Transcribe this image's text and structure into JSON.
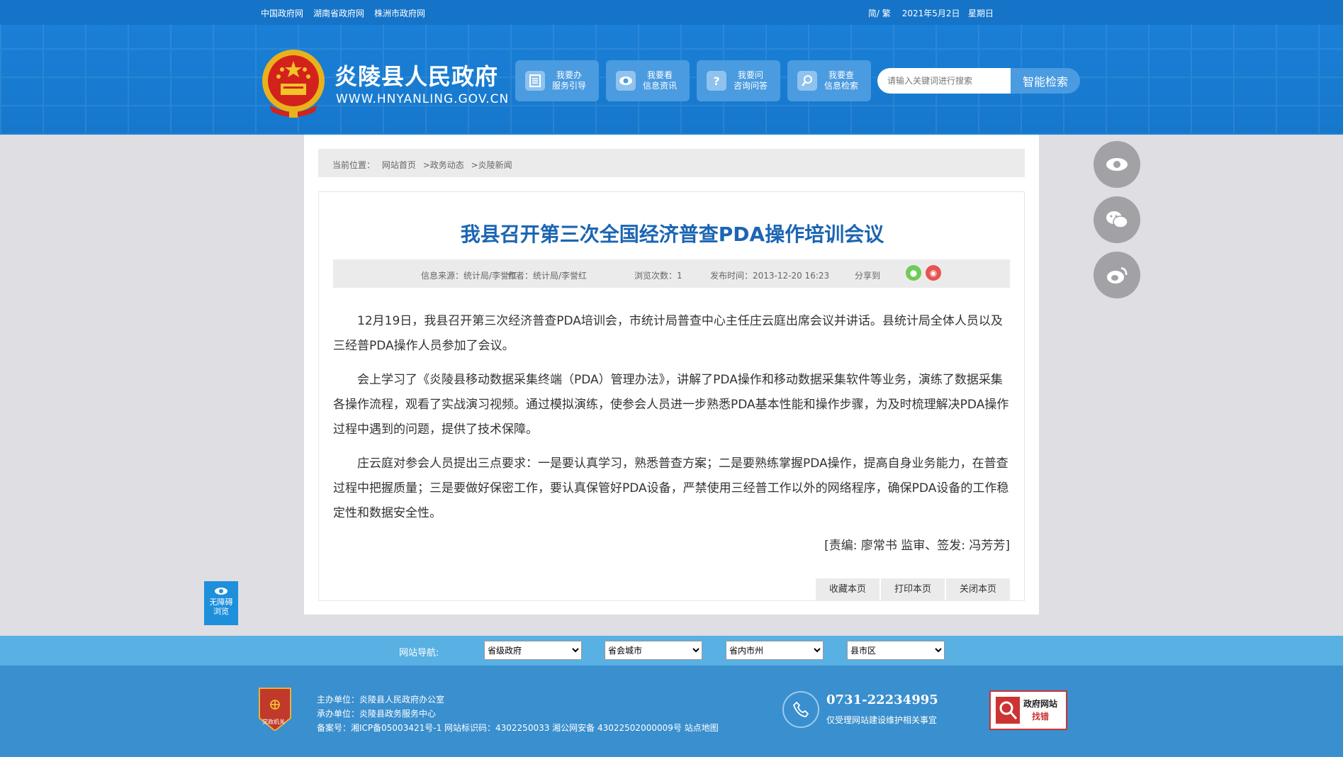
{
  "topbar": {
    "links": [
      "中国政府网",
      "湖南省政府网",
      "株洲市政府网"
    ],
    "lang": "简/ 繁",
    "date": "2021年5月2日",
    "weekday": "星期日"
  },
  "header": {
    "title": "炎陵县人民政府",
    "url": "WWW.HNYANLING.GOV.CN",
    "nav": [
      {
        "line1": "我要办",
        "line2": "服务引导",
        "icon": "document-icon"
      },
      {
        "line1": "我要看",
        "line2": "信息资讯",
        "icon": "eye-icon"
      },
      {
        "line1": "我要问",
        "line2": "咨询问答",
        "icon": "question-icon"
      },
      {
        "line1": "我要查",
        "line2": "信息检索",
        "icon": "search-icon"
      }
    ],
    "search_placeholder": "请输入关键词进行搜索",
    "search_button": "智能检索"
  },
  "breadcrumb": {
    "label": "当前位置：",
    "items": [
      "网站首页",
      ">政务动态",
      ">炎陵新闻"
    ]
  },
  "article": {
    "title": "我县召开第三次全国经济普查PDA操作培训会议",
    "source": "信息来源：统计局/李誉红",
    "author": "作者：统计局/李誉红",
    "views": "浏览次数：1",
    "published": "发布时间：2013-12-20 16:23",
    "share": "分享到",
    "paragraphs": [
      "12月19日，我县召开第三次经济普查PDA培训会，市统计局普查中心主任庄云庭出席会议并讲话。县统计局全体人员以及三经普PDA操作人员参加了会议。",
      "会上学习了《炎陵县移动数据采集终端（PDA）管理办法》，讲解了PDA操作和移动数据采集软件等业务，演练了数据采集各操作流程，观看了实战演习视频。通过模拟演练，使参会人员进一步熟悉PDA基本性能和操作步骤，为及时梳理解决PDA操作过程中遇到的问题，提供了技术保障。",
      "庄云庭对参会人员提出三点要求：一是要认真学习，熟悉普查方案；二是要熟练掌握PDA操作，提高自身业务能力，在普查过程中把握质量；三是要做好保密工作，要认真保管好PDA设备，严禁使用三经普工作以外的网络程序，确保PDA设备的工作稳定性和数据安全性。"
    ],
    "editor": "[责编: 廖常书  监审、签发: 冯芳芳]",
    "actions": [
      "收藏本页",
      "打印本页",
      "关闭本页"
    ]
  },
  "accessibility": {
    "line1": "无障碍",
    "line2": "浏览"
  },
  "footnav": {
    "label": "网站导航:",
    "selects": [
      "省级政府",
      "省会城市",
      "省内市州",
      "县市区"
    ]
  },
  "footer": {
    "host": "主办单位：炎陵县人民政府办公室",
    "organizer": "承办单位：炎陵县政务服务中心",
    "record": "备案号：湘ICP备05003421号-1  网站标识码：4302250033  湘公网安备 43022502000009号  站点地图",
    "phone": "0731-22234995",
    "phone_note": "仅受理网站建设维护相关事宜",
    "jiucuo_line1": "政府网站",
    "jiucuo_line2": "找错",
    "badge_text": "党政机关"
  },
  "colors": {
    "header_blue": "#1674c8",
    "title_blue": "#1b65b3",
    "footer_blue": "#3a8fce",
    "nav_blue": "#58b0e3"
  }
}
